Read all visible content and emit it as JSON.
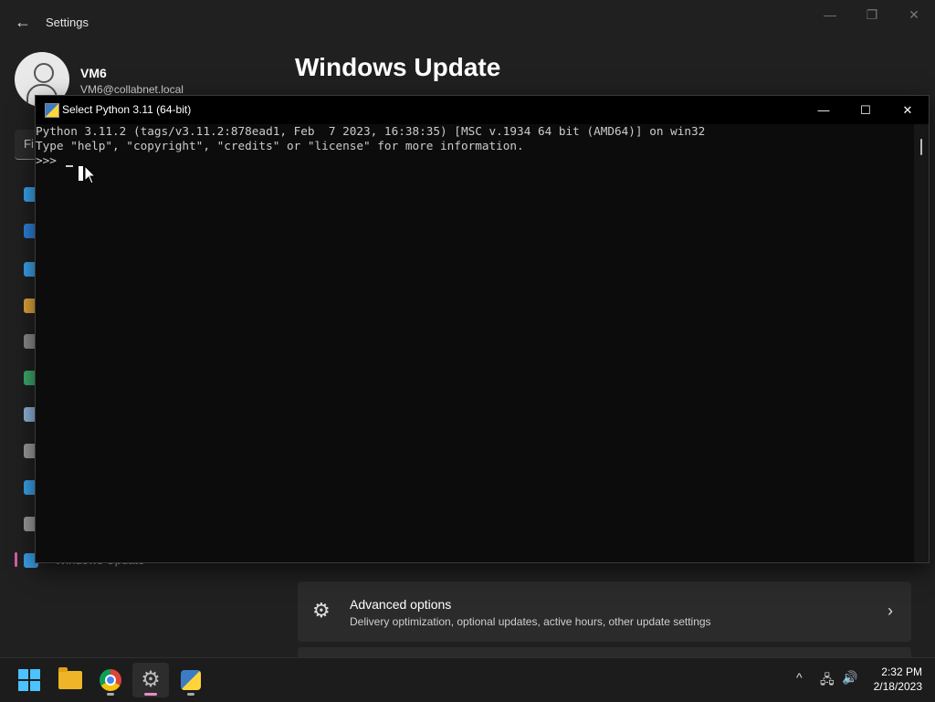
{
  "settings": {
    "title": "Settings",
    "user_name": "VM6",
    "user_email": "VM6@collabnet.local",
    "page_heading": "Windows Update",
    "find_placeholder": "Fi",
    "active_nav_label": "Windows Update",
    "nav_icon_colors": [
      "#3aa0e8",
      "#2b7fd9",
      "#3aa0e8",
      "#e0a43a",
      "#8a8a8a",
      "#3ca86a",
      "#8fb3d9",
      "#9a9a9a",
      "#3aa0e8",
      "#9a9a9a",
      "#3aa0e8"
    ],
    "advanced_options": {
      "title": "Advanced options",
      "description": "Delivery optimization, optional updates, active hours, other update settings"
    },
    "window_controls": {
      "minimize": "—",
      "maximize": "❐",
      "close": "✕"
    }
  },
  "console": {
    "title": "Select Python 3.11 (64-bit)",
    "lines": [
      "Python 3.11.2 (tags/v3.11.2:878ead1, Feb  7 2023, 16:38:35) [MSC v.1934 64 bit (AMD64)] on win32",
      "Type \"help\", \"copyright\", \"credits\" or \"license\" for more information.",
      ">>> "
    ],
    "controls": {
      "minimize": "—",
      "maximize": "☐",
      "close": "✕"
    }
  },
  "taskbar": {
    "apps": [
      "start",
      "file-explorer",
      "chrome",
      "settings",
      "python"
    ],
    "active_app": "settings",
    "tray": {
      "chevron": "^",
      "network": "🖧",
      "volume": "🔊"
    },
    "time": "2:32 PM",
    "date": "2/18/2023"
  },
  "colors": {
    "accent": "#4cc2ff",
    "active_indicator": "#e58ec7"
  }
}
